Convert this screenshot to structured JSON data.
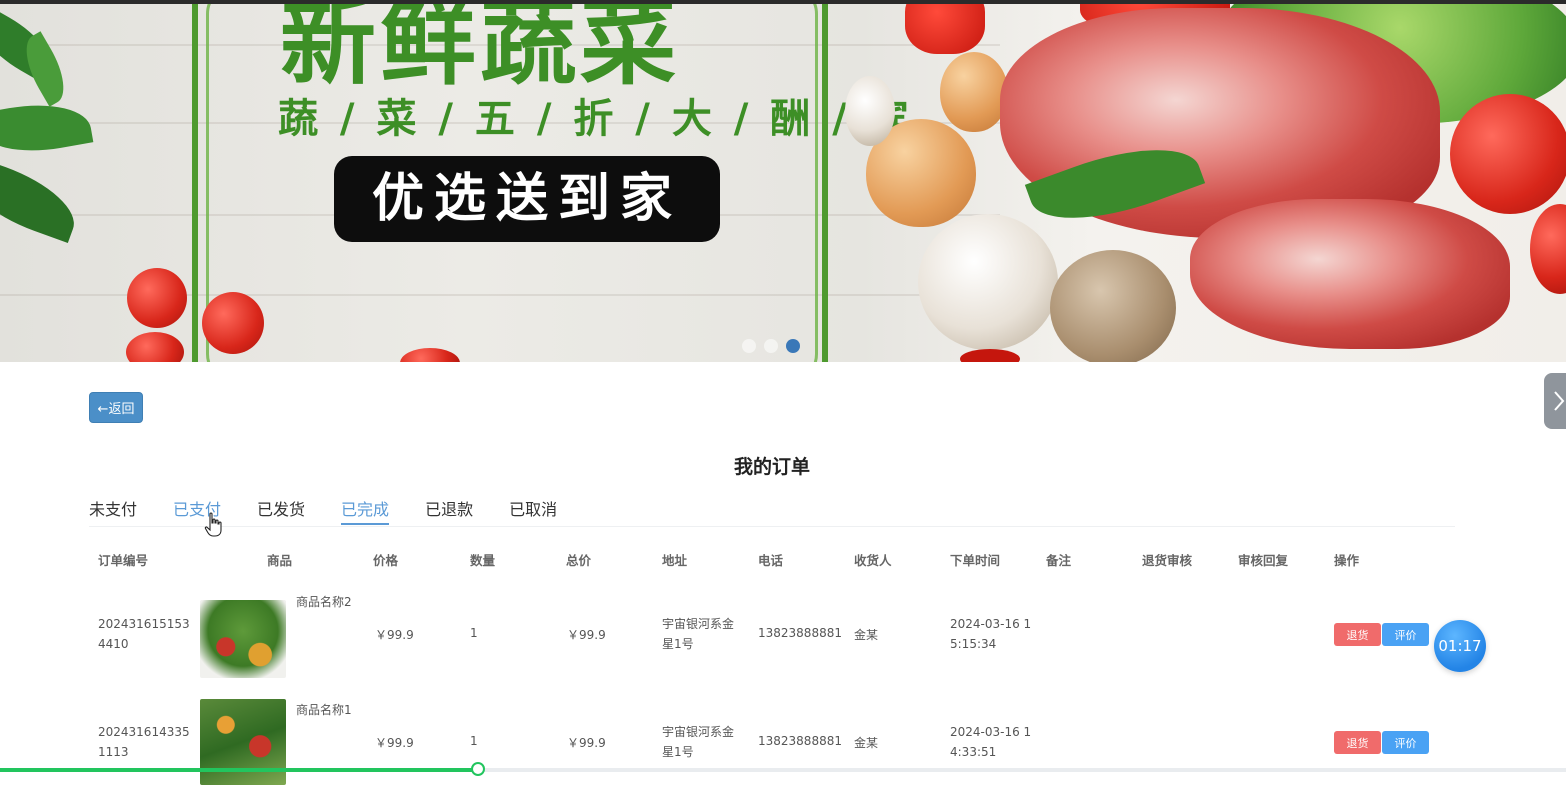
{
  "banner": {
    "title": "新鲜蔬菜",
    "subtitle": "蔬 / 菜 / 五 / 折 / 大 / 酬 / 宾",
    "badge": "优选送到家",
    "slide_count": 3,
    "active_slide": 2
  },
  "nav": {
    "back_label": "←返回",
    "drawer_icon": "chevron-right-icon"
  },
  "page": {
    "title": "我的订单"
  },
  "tabs": [
    {
      "label": "未支付",
      "state": "normal"
    },
    {
      "label": "已支付",
      "state": "hover"
    },
    {
      "label": "已发货",
      "state": "normal"
    },
    {
      "label": "已完成",
      "state": "active"
    },
    {
      "label": "已退款",
      "state": "normal"
    },
    {
      "label": "已取消",
      "state": "normal"
    }
  ],
  "table": {
    "headers": [
      "订单编号",
      "商品",
      "价格",
      "数量",
      "总价",
      "地址",
      "电话",
      "收货人",
      "下单时间",
      "备注",
      "退货审核",
      "审核回复",
      "操作"
    ],
    "rows": [
      {
        "order_no_l1": "202431615153",
        "order_no_l2": "4410",
        "product_name": "商品名称2",
        "price": "￥99.9",
        "qty": "1",
        "total": "￥99.9",
        "address_l1": "宇宙银河系金",
        "address_l2": "星1号",
        "phone": "13823888881",
        "receiver": "金某",
        "time_l1": "2024-03-16 1",
        "time_l2": "5:15:34",
        "remark": "",
        "return_review": "",
        "review_reply": "",
        "actions": [
          "退货",
          "评价"
        ]
      },
      {
        "order_no_l1": "202431614335",
        "order_no_l2": "1113",
        "product_name": "商品名称1",
        "price": "￥99.9",
        "qty": "1",
        "total": "￥99.9",
        "address_l1": "宇宙银河系金",
        "address_l2": "星1号",
        "phone": "13823888881",
        "receiver": "金某",
        "time_l1": "2024-03-16 1",
        "time_l2": "4:33:51",
        "remark": "",
        "return_review": "",
        "review_reply": "",
        "actions": [
          "退货",
          "评价"
        ]
      }
    ]
  },
  "timer": {
    "label": "01:17"
  },
  "progress": {
    "value": 0.305
  },
  "colors": {
    "accent": "#5b9ad6",
    "back_button": "#4b8fc8",
    "danger": "#f06b6b",
    "primary": "#4aa2f4",
    "progress": "#22c55e"
  }
}
